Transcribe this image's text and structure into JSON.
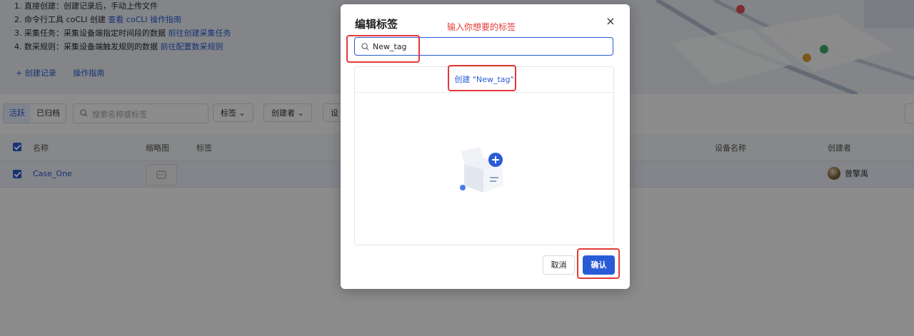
{
  "banner": {
    "steps": [
      {
        "text": "1. 直接创建：创建记录后，手动上传文件",
        "link": "",
        "link2": ""
      },
      {
        "text": "2. 命令行工具 coCLI 创建 ",
        "link": "查看 coCLI 操作指南",
        "link2": ""
      },
      {
        "text": "3. 采集任务：采集设备端指定时间段的数据 ",
        "link": "前往创建采集任务",
        "link2": ""
      },
      {
        "text": "4. 数采规则：采集设备端触发规则的数据 ",
        "link": "前往配置数采规则",
        "link2": ""
      }
    ],
    "create_record": "+ 创建记录",
    "guide": "操作指南"
  },
  "toolbar": {
    "tab_active": "活跃",
    "tab_archived": "已归档",
    "search_placeholder": "搜索名称或标签",
    "filter_tag": "标签",
    "filter_creator": "创建者",
    "filter_device": "设"
  },
  "table": {
    "columns": {
      "name": "名称",
      "thumbnail": "缩略图",
      "tags": "标签",
      "device": "设备名称",
      "creator": "创建者"
    },
    "row": {
      "name": "Case_One",
      "creator": "曾擎禹"
    }
  },
  "modal": {
    "title": "编辑标签",
    "hint": "输入你想要的标签",
    "input_value": "New_tag",
    "create_option": "创建 \"New_tag\"",
    "cancel": "取消",
    "confirm": "确认"
  },
  "colors": {
    "accent": "#2a5bd7",
    "annotation": "#e53935"
  },
  "icons": [
    "search-icon",
    "chevron-down-icon",
    "close-icon",
    "empty-box-icon",
    "refresh-icon"
  ]
}
